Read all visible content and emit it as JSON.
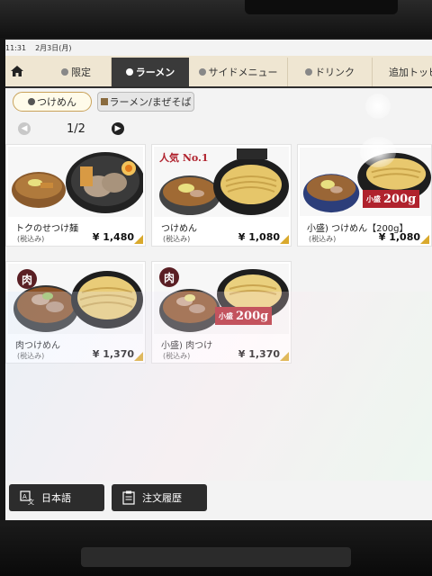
{
  "status": {
    "time": "11:31",
    "date": "2月3日(月)"
  },
  "tabs": [
    {
      "label": "限定",
      "active": false
    },
    {
      "label": "ラーメン",
      "active": true
    },
    {
      "label": "サイドメニュー",
      "active": false
    },
    {
      "label": "ドリンク",
      "active": false
    },
    {
      "label": "追加トッピ",
      "active": false
    }
  ],
  "subtabs": [
    {
      "label": "つけめん",
      "active": true
    },
    {
      "label": "ラーメン/まぜそば",
      "active": false
    }
  ],
  "pager": {
    "label": "1/2"
  },
  "items": [
    {
      "name": "トクのせつけ麺",
      "tax": "(税込み)",
      "price": "¥ 1,480"
    },
    {
      "name": "つけめん",
      "tax": "(税込み)",
      "price": "¥ 1,080",
      "badge": "人気 No.1"
    },
    {
      "name": "小盛) つけめん【200g】",
      "tax": "(税込み)",
      "price": "¥ 1,080",
      "size_small": "小盛",
      "size_grams": "200g"
    },
    {
      "name": "肉つけめん",
      "tax": "(税込み)",
      "price": "¥ 1,370",
      "meat": "肉"
    },
    {
      "name": "小盛) 肉つけ",
      "tax": "(税込み)",
      "price": "¥ 1,370",
      "meat": "肉",
      "size_small": "小盛",
      "size_grams": "200g"
    }
  ],
  "footer": {
    "language_label": "日本語",
    "history_label": "注文履歴"
  },
  "icons": [
    "home-icon",
    "prev-page-icon",
    "next-page-icon",
    "language-icon",
    "order-history-icon"
  ],
  "colors": {
    "accent_red": "#b0222d",
    "tab_active": "#3a3a3a",
    "price_corner": "#d9a92c"
  }
}
